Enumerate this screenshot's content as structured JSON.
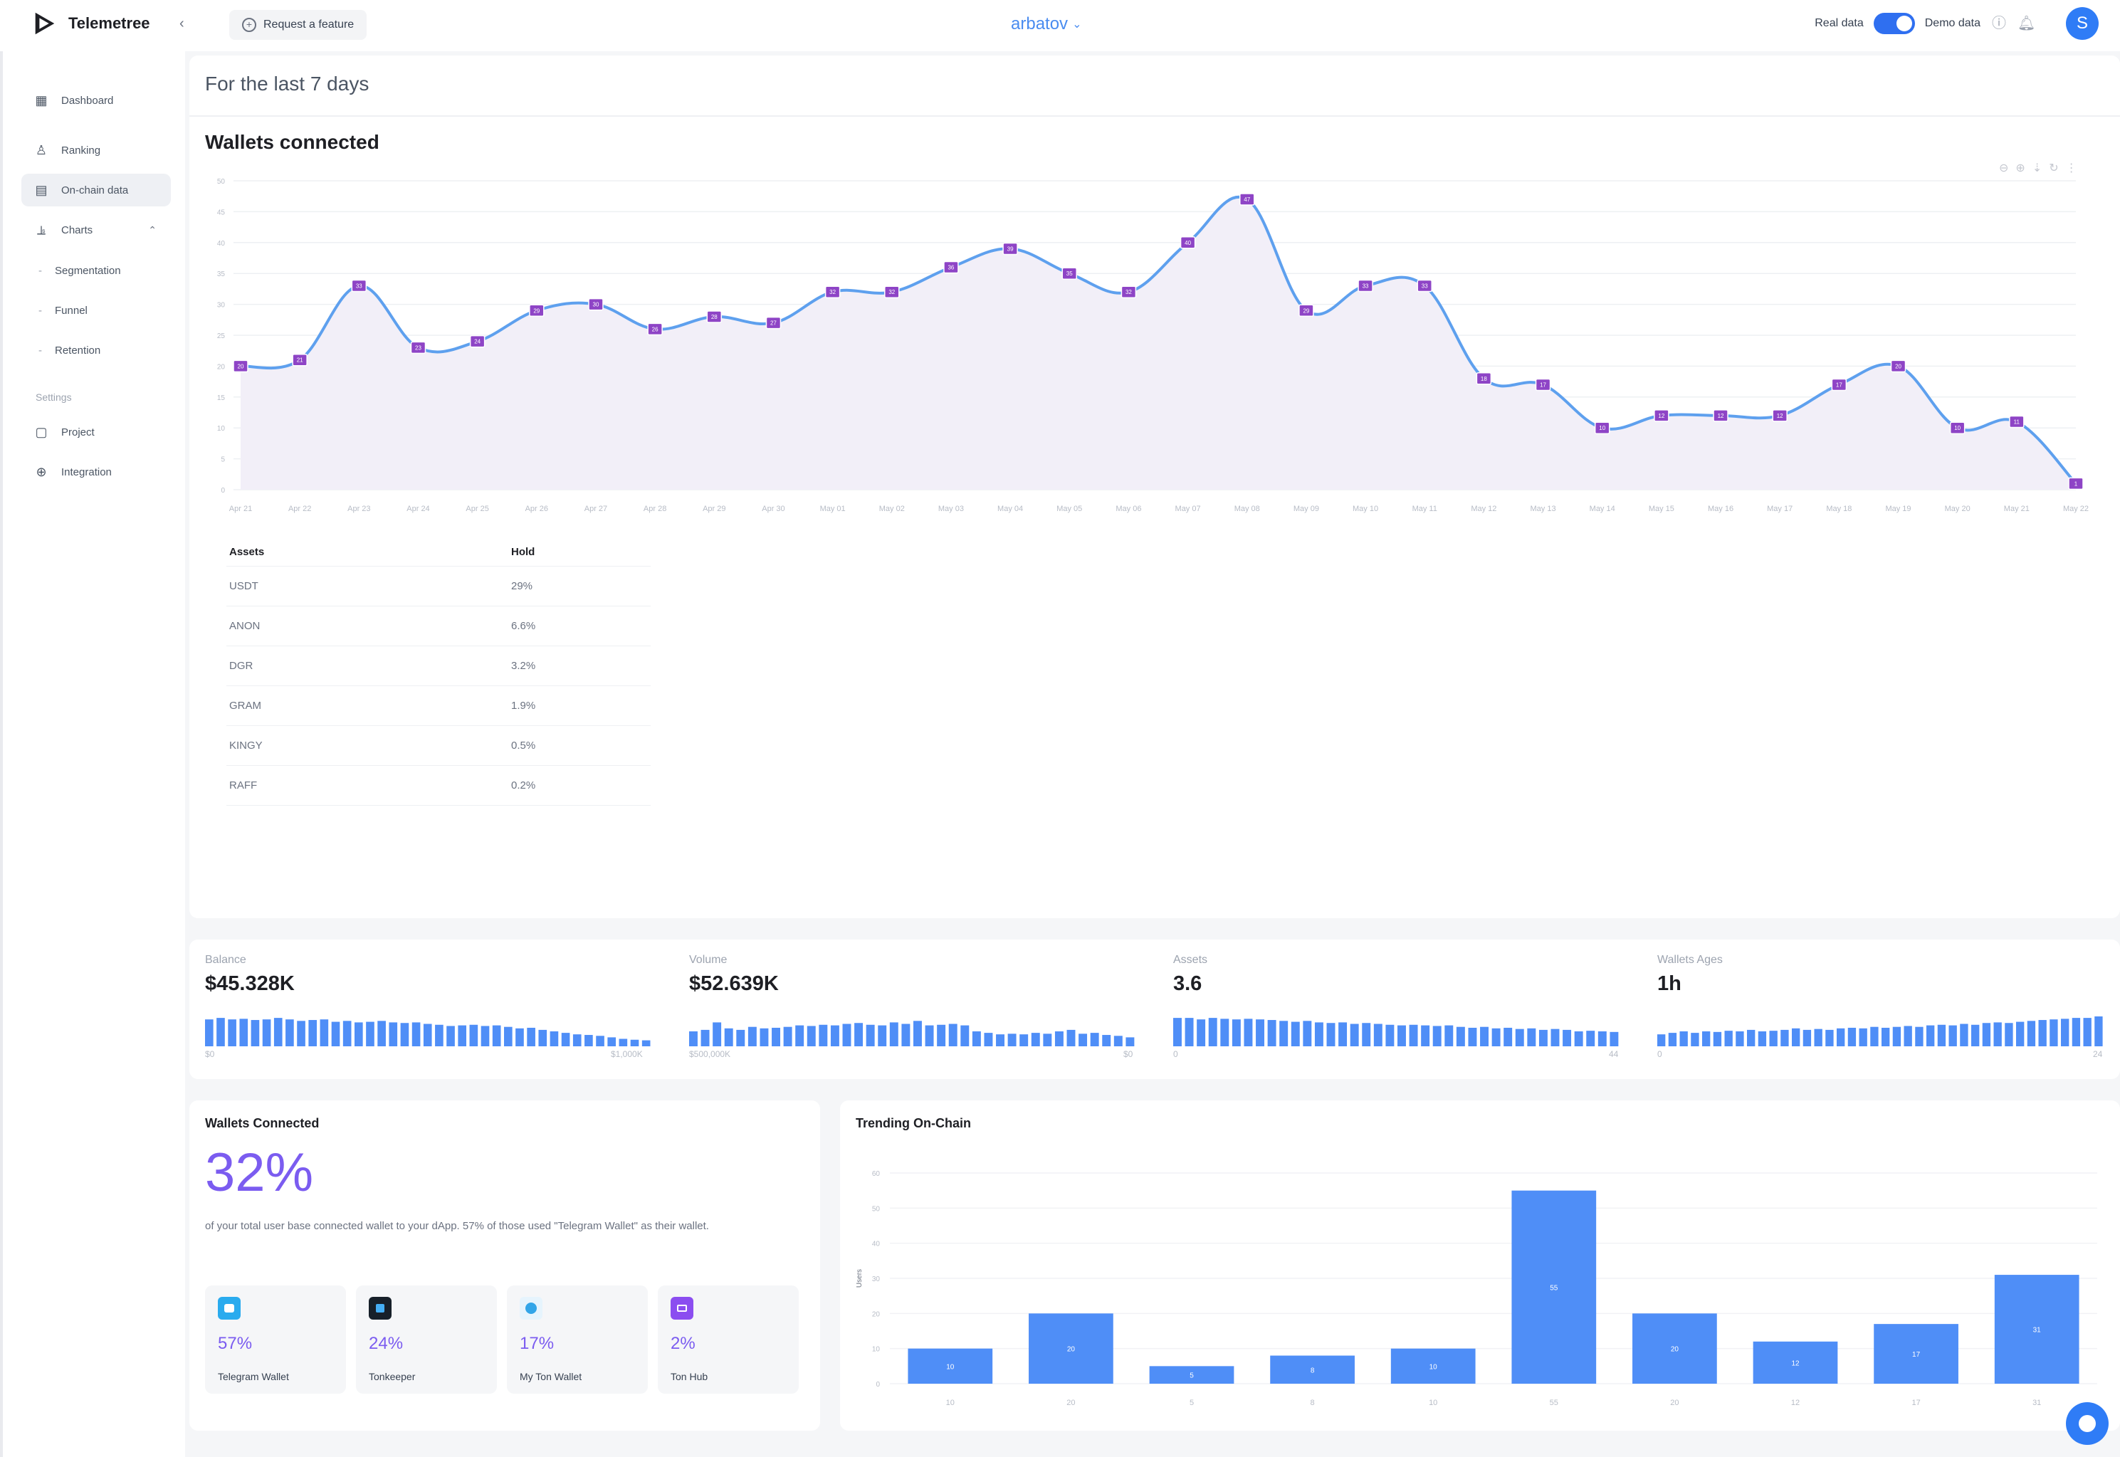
{
  "app": {
    "name": "Telemetree",
    "feature_request": "Request a feature",
    "project": "arbatov",
    "real_data": "Real data",
    "demo_data": "Demo data",
    "avatar_letter": "S"
  },
  "sidebar": {
    "items": [
      {
        "label": "Dashboard",
        "icon": "grid-icon"
      },
      {
        "label": "Ranking",
        "icon": "user-icon"
      },
      {
        "label": "On-chain data",
        "icon": "blocks-icon"
      },
      {
        "label": "Charts",
        "icon": "chart-icon"
      }
    ],
    "sub_items": [
      "Segmentation",
      "Funnel",
      "Retention"
    ],
    "settings_label": "Settings",
    "settings_items": [
      {
        "label": "Project",
        "icon": "project-icon"
      },
      {
        "label": "Integration",
        "icon": "integration-icon"
      }
    ]
  },
  "main": {
    "period": "For the last 7 days",
    "chart_title": "Wallets connected"
  },
  "chart_data": [
    {
      "type": "line",
      "title": "Wallets connected",
      "x": [
        "Apr 21",
        "Apr 22",
        "Apr 23",
        "Apr 24",
        "Apr 25",
        "Apr 26",
        "Apr 27",
        "Apr 28",
        "Apr 29",
        "Apr 30",
        "May 01",
        "May 02",
        "May 03",
        "May 04",
        "May 05",
        "May 06",
        "May 07",
        "May 08",
        "May 09",
        "May 10",
        "May 11",
        "May 12",
        "May 13",
        "May 14",
        "May 15",
        "May 16",
        "May 17",
        "May 18",
        "May 19",
        "May 20",
        "May 21",
        "May 22"
      ],
      "series": [
        {
          "values": [
            20,
            21,
            33,
            23,
            24,
            29,
            30,
            26,
            28,
            27,
            32,
            32,
            36,
            39,
            35,
            32,
            40,
            47,
            29,
            33,
            33,
            18,
            17,
            10,
            12,
            12,
            12,
            17,
            20,
            10,
            11,
            1
          ]
        }
      ],
      "ylim": [
        0,
        50
      ],
      "yticks": [
        0,
        5,
        10,
        15,
        20,
        25,
        30,
        35,
        40,
        45,
        50
      ],
      "grid": true
    },
    {
      "type": "bar",
      "title": "Trending On-Chain",
      "ylabel": "Users",
      "categories": [
        "10",
        "20",
        "5",
        "8",
        "10",
        "55",
        "20",
        "12",
        "17",
        "31"
      ],
      "values": [
        10,
        20,
        5,
        8,
        10,
        55,
        20,
        12,
        17,
        31
      ],
      "ylim": [
        0,
        60
      ],
      "yticks": [
        0,
        10,
        20,
        30,
        40,
        50,
        60
      ]
    }
  ],
  "assets": {
    "headers": [
      "Assets",
      "Hold"
    ],
    "rows": [
      [
        "USDT",
        "29%"
      ],
      [
        "ANON",
        "6.6%"
      ],
      [
        "DGR",
        "3.2%"
      ],
      [
        "GRAM",
        "1.9%"
      ],
      [
        "KINGY",
        "0.5%"
      ],
      [
        "RAFF",
        "0.2%"
      ]
    ]
  },
  "stats": [
    {
      "label": "Balance",
      "value": "$45.328K",
      "axis_left": "$0",
      "axis_right": "$1,000K",
      "bars": [
        0.9,
        0.95,
        0.9,
        0.92,
        0.88,
        0.9,
        0.95,
        0.9,
        0.85,
        0.88,
        0.9,
        0.82,
        0.85,
        0.8,
        0.82,
        0.85,
        0.8,
        0.78,
        0.8,
        0.75,
        0.72,
        0.68,
        0.7,
        0.72,
        0.68,
        0.7,
        0.65,
        0.6,
        0.62,
        0.55,
        0.5,
        0.45,
        0.4,
        0.38,
        0.35,
        0.3,
        0.25,
        0.22,
        0.2
      ]
    },
    {
      "label": "Volume",
      "value": "$52.639K",
      "axis_left": "$500,000K",
      "axis_right": "$0",
      "bars": [
        0.5,
        0.55,
        0.8,
        0.6,
        0.55,
        0.65,
        0.6,
        0.62,
        0.65,
        0.7,
        0.68,
        0.72,
        0.7,
        0.75,
        0.78,
        0.72,
        0.7,
        0.8,
        0.75,
        0.85,
        0.7,
        0.72,
        0.75,
        0.7,
        0.5,
        0.45,
        0.4,
        0.42,
        0.4,
        0.45,
        0.42,
        0.5,
        0.55,
        0.42,
        0.45,
        0.38,
        0.35,
        0.3
      ]
    },
    {
      "label": "Assets",
      "value": "3.6",
      "axis_left": "0",
      "axis_right": "44",
      "bars": [
        0.95,
        0.95,
        0.9,
        0.95,
        0.92,
        0.9,
        0.92,
        0.9,
        0.88,
        0.85,
        0.82,
        0.85,
        0.8,
        0.78,
        0.8,
        0.75,
        0.78,
        0.75,
        0.72,
        0.7,
        0.72,
        0.7,
        0.68,
        0.7,
        0.65,
        0.62,
        0.65,
        0.6,
        0.62,
        0.58,
        0.6,
        0.55,
        0.58,
        0.55,
        0.5,
        0.52,
        0.5,
        0.48
      ]
    },
    {
      "label": "Wallets Ages",
      "value": "1h",
      "axis_left": "0",
      "axis_right": "24",
      "bars": [
        0.4,
        0.45,
        0.5,
        0.45,
        0.5,
        0.48,
        0.52,
        0.5,
        0.55,
        0.5,
        0.52,
        0.55,
        0.6,
        0.55,
        0.58,
        0.55,
        0.6,
        0.62,
        0.6,
        0.65,
        0.62,
        0.65,
        0.68,
        0.65,
        0.7,
        0.72,
        0.7,
        0.75,
        0.72,
        0.78,
        0.8,
        0.78,
        0.82,
        0.85,
        0.88,
        0.9,
        0.92,
        0.95,
        0.95,
        1.0
      ]
    }
  ],
  "wallets_connected": {
    "title": "Wallets Connected",
    "percent": "32%",
    "description": "of your total user base connected wallet to your dApp. 57% of those used \"Telegram Wallet\" as their wallet.",
    "wallets": [
      {
        "pct": "57%",
        "name": "Telegram Wallet",
        "icon": "telegram-wallet-icon",
        "color": "#2aabee"
      },
      {
        "pct": "24%",
        "name": "Tonkeeper",
        "icon": "tonkeeper-icon",
        "color": "#17202a"
      },
      {
        "pct": "17%",
        "name": "My Ton Wallet",
        "icon": "mytonwallet-icon",
        "color": "#32a5e8"
      },
      {
        "pct": "2%",
        "name": "Ton Hub",
        "icon": "tonhub-icon",
        "color": "#8b4df0"
      }
    ]
  },
  "trending": {
    "title": "Trending On-Chain"
  },
  "colors": {
    "accent": "#4a8cf0",
    "purple": "#7b5cf0",
    "bar": "#4f8ef7"
  }
}
